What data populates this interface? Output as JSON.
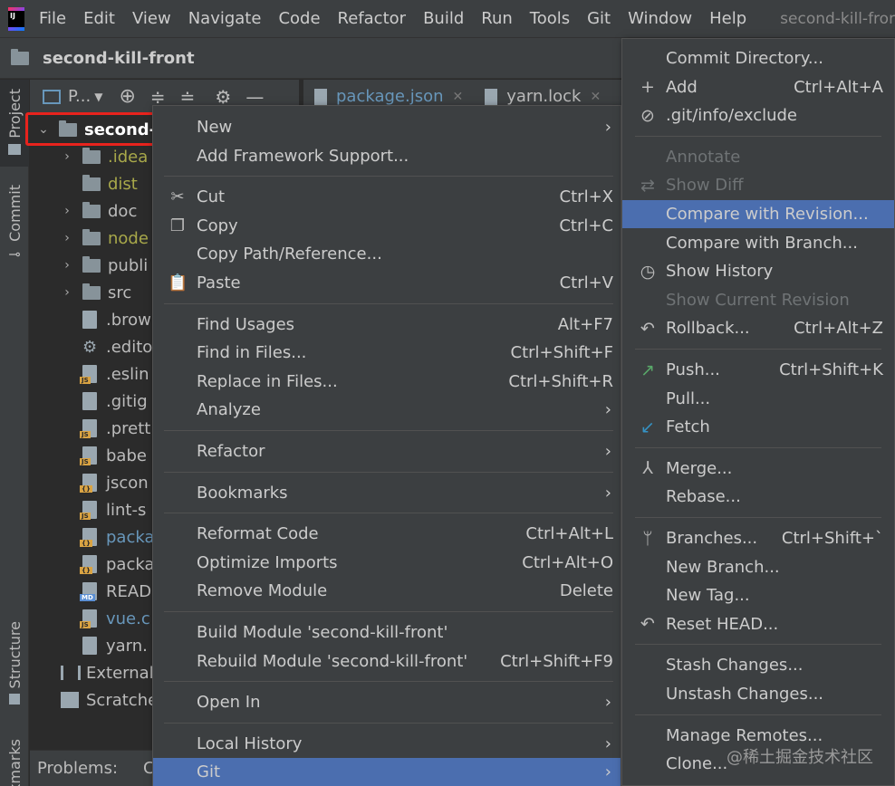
{
  "menubar": {
    "logo_text": "IJ",
    "items": [
      "File",
      "Edit",
      "View",
      "Navigate",
      "Code",
      "Refactor",
      "Build",
      "Run",
      "Tools",
      "Git",
      "Window",
      "Help"
    ],
    "window_title": "second-kill-front"
  },
  "navbar": {
    "project_name": "second-kill-front"
  },
  "left_stripe": {
    "project_tab": "Project",
    "commit_tab": "Commit",
    "structure_tab": "Structure",
    "bookmarks_tab": "kmarks"
  },
  "project_toolbar": {
    "view_label": "P..."
  },
  "editor_tabs": [
    {
      "name": "package.json"
    },
    {
      "name": "yarn.lock"
    }
  ],
  "tree": {
    "root": "second-",
    "items": [
      {
        "label": ".idea",
        "type": "folder",
        "chevron": true,
        "color": "#a8a84a"
      },
      {
        "label": "dist",
        "type": "folder",
        "chevron": false,
        "color": "#a8a84a"
      },
      {
        "label": "doc",
        "type": "folder",
        "chevron": true,
        "color": "#bbbbbb"
      },
      {
        "label": "node",
        "type": "folder",
        "chevron": true,
        "color": "#a8a84a"
      },
      {
        "label": "publi",
        "type": "folder",
        "chevron": true,
        "color": "#bbbbbb"
      },
      {
        "label": "src",
        "type": "folder",
        "chevron": true,
        "color": "#bbbbbb"
      },
      {
        "label": ".brow",
        "type": "file",
        "tag": "",
        "color": "#bbbbbb"
      },
      {
        "label": ".edito",
        "type": "gear",
        "tag": "",
        "color": "#bbbbbb"
      },
      {
        "label": ".eslin",
        "type": "file",
        "tag": "JS",
        "color": "#bbbbbb"
      },
      {
        "label": ".gitig",
        "type": "file",
        "tag": "",
        "color": "#bbbbbb"
      },
      {
        "label": ".prett",
        "type": "file",
        "tag": "JS",
        "color": "#bbbbbb"
      },
      {
        "label": "babe",
        "type": "file",
        "tag": "JS",
        "color": "#bbbbbb"
      },
      {
        "label": "jscon",
        "type": "file",
        "tag": "{}",
        "color": "#bbbbbb"
      },
      {
        "label": "lint-s",
        "type": "file",
        "tag": "JS",
        "color": "#bbbbbb"
      },
      {
        "label": "packa",
        "type": "file",
        "tag": "{}",
        "color": "#6897bb"
      },
      {
        "label": "packa",
        "type": "file",
        "tag": "{}",
        "color": "#bbbbbb"
      },
      {
        "label": "READ",
        "type": "file",
        "tag": "MD",
        "color": "#bbbbbb"
      },
      {
        "label": "vue.c",
        "type": "file",
        "tag": "JS",
        "color": "#6897bb"
      },
      {
        "label": "yarn.",
        "type": "file",
        "tag": "",
        "color": "#bbbbbb"
      }
    ],
    "external": "External",
    "scratches": "Scratche"
  },
  "bottom_bar": {
    "problems": "Problems:",
    "extra": "C"
  },
  "context_menu": [
    {
      "label": "New",
      "shortcut": "",
      "submenu": true,
      "icon": ""
    },
    {
      "label": "Add Framework Support...",
      "shortcut": "",
      "submenu": false,
      "icon": ""
    },
    {
      "sep": true
    },
    {
      "label": "Cut",
      "shortcut": "Ctrl+X",
      "submenu": false,
      "icon": "✂"
    },
    {
      "label": "Copy",
      "shortcut": "Ctrl+C",
      "submenu": false,
      "icon": "❐"
    },
    {
      "label": "Copy Path/Reference...",
      "shortcut": "",
      "submenu": false,
      "icon": ""
    },
    {
      "label": "Paste",
      "shortcut": "Ctrl+V",
      "submenu": false,
      "icon": "📋"
    },
    {
      "sep": true
    },
    {
      "label": "Find Usages",
      "shortcut": "Alt+F7",
      "submenu": false,
      "icon": ""
    },
    {
      "label": "Find in Files...",
      "shortcut": "Ctrl+Shift+F",
      "submenu": false,
      "icon": ""
    },
    {
      "label": "Replace in Files...",
      "shortcut": "Ctrl+Shift+R",
      "submenu": false,
      "icon": ""
    },
    {
      "label": "Analyze",
      "shortcut": "",
      "submenu": true,
      "icon": ""
    },
    {
      "sep": true
    },
    {
      "label": "Refactor",
      "shortcut": "",
      "submenu": true,
      "icon": ""
    },
    {
      "sep": true
    },
    {
      "label": "Bookmarks",
      "shortcut": "",
      "submenu": true,
      "icon": ""
    },
    {
      "sep": true
    },
    {
      "label": "Reformat Code",
      "shortcut": "Ctrl+Alt+L",
      "submenu": false,
      "icon": ""
    },
    {
      "label": "Optimize Imports",
      "shortcut": "Ctrl+Alt+O",
      "submenu": false,
      "icon": ""
    },
    {
      "label": "Remove Module",
      "shortcut": "Delete",
      "submenu": false,
      "icon": ""
    },
    {
      "sep": true
    },
    {
      "label": "Build Module 'second-kill-front'",
      "shortcut": "",
      "submenu": false,
      "icon": ""
    },
    {
      "label": "Rebuild Module 'second-kill-front'",
      "shortcut": "Ctrl+Shift+F9",
      "submenu": false,
      "icon": ""
    },
    {
      "sep": true
    },
    {
      "label": "Open In",
      "shortcut": "",
      "submenu": true,
      "icon": ""
    },
    {
      "sep": true
    },
    {
      "label": "Local History",
      "shortcut": "",
      "submenu": true,
      "icon": ""
    },
    {
      "label": "Git",
      "shortcut": "",
      "submenu": true,
      "icon": "",
      "selected": true
    }
  ],
  "git_menu": [
    {
      "label": "Commit Directory...",
      "shortcut": "",
      "icon": ""
    },
    {
      "label": "Add",
      "shortcut": "Ctrl+Alt+A",
      "icon": "+"
    },
    {
      "label": ".git/info/exclude",
      "shortcut": "",
      "icon": "⊘"
    },
    {
      "sep": true
    },
    {
      "label": "Annotate",
      "shortcut": "",
      "icon": "",
      "disabled": true
    },
    {
      "label": "Show Diff",
      "shortcut": "",
      "icon": "⇄",
      "disabled": true
    },
    {
      "label": "Compare with Revision...",
      "shortcut": "",
      "icon": "",
      "selected": true
    },
    {
      "label": "Compare with Branch...",
      "shortcut": "",
      "icon": ""
    },
    {
      "label": "Show History",
      "shortcut": "",
      "icon": "◷"
    },
    {
      "label": "Show Current Revision",
      "shortcut": "",
      "icon": "",
      "disabled": true
    },
    {
      "label": "Rollback...",
      "shortcut": "Ctrl+Alt+Z",
      "icon": "↶"
    },
    {
      "sep": true
    },
    {
      "label": "Push...",
      "shortcut": "Ctrl+Shift+K",
      "icon": "↗",
      "icon_color": "#59a869"
    },
    {
      "label": "Pull...",
      "shortcut": "",
      "icon": ""
    },
    {
      "label": "Fetch",
      "shortcut": "",
      "icon": "↙",
      "icon_color": "#3592c4"
    },
    {
      "sep": true
    },
    {
      "label": "Merge...",
      "shortcut": "",
      "icon": "⅄"
    },
    {
      "label": "Rebase...",
      "shortcut": "",
      "icon": ""
    },
    {
      "sep": true
    },
    {
      "label": "Branches...",
      "shortcut": "Ctrl+Shift+`",
      "icon": "ᛘ"
    },
    {
      "label": "New Branch...",
      "shortcut": "",
      "icon": ""
    },
    {
      "label": "New Tag...",
      "shortcut": "",
      "icon": ""
    },
    {
      "label": "Reset HEAD...",
      "shortcut": "",
      "icon": "↶"
    },
    {
      "sep": true
    },
    {
      "label": "Stash Changes...",
      "shortcut": "",
      "icon": ""
    },
    {
      "label": "Unstash Changes...",
      "shortcut": "",
      "icon": ""
    },
    {
      "sep": true
    },
    {
      "label": "Manage Remotes...",
      "shortcut": "",
      "icon": ""
    },
    {
      "label": "Clone...",
      "shortcut": "",
      "icon": ""
    }
  ],
  "watermark": "@稀土掘金技术社区"
}
